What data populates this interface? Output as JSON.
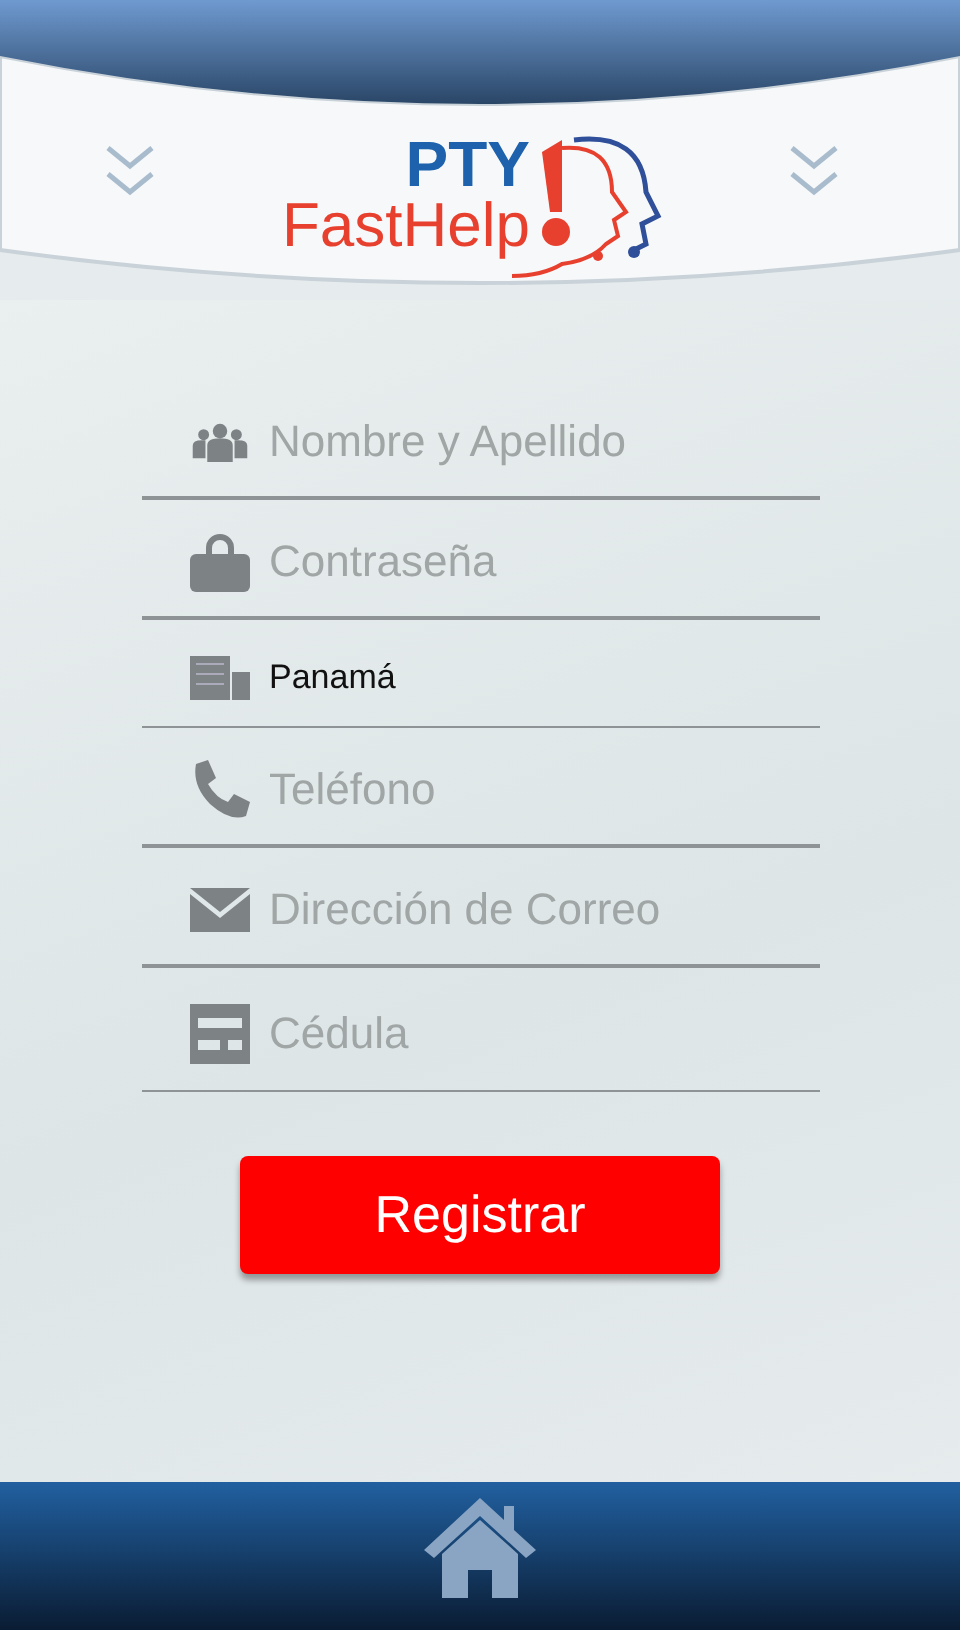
{
  "header": {
    "logo": {
      "line_1": "PTY",
      "line_2": "FastHelp"
    }
  },
  "form": {
    "fields": [
      {
        "kind": "people",
        "placeholder": "Nombre y Apellido"
      },
      {
        "kind": "lock",
        "placeholder": "Contraseña"
      },
      {
        "kind": "building",
        "value": "Panamá"
      },
      {
        "kind": "phone",
        "placeholder": "Teléfono"
      },
      {
        "kind": "mail",
        "placeholder": "Dirección de Correo"
      },
      {
        "kind": "card",
        "placeholder": "Cédula"
      }
    ],
    "submit": "Registrar"
  }
}
